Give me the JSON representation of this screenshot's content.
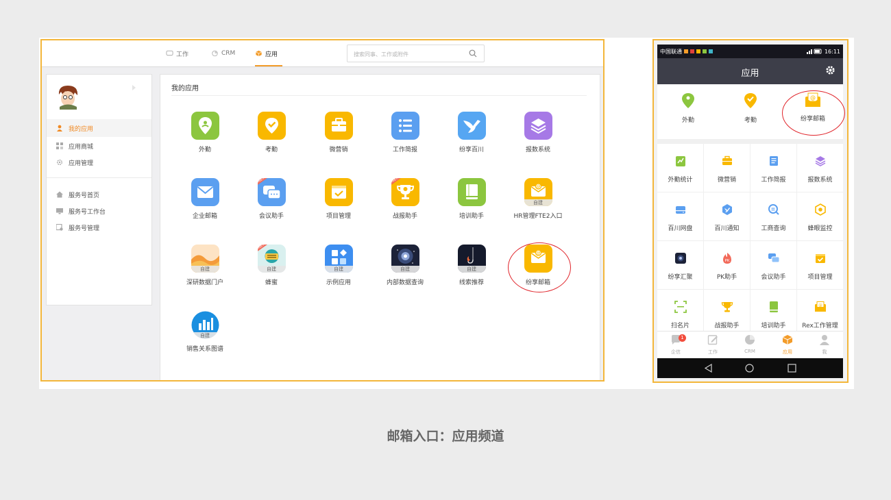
{
  "desktop": {
    "tabs": [
      {
        "label": "工作",
        "icon": "chat-icon"
      },
      {
        "label": "CRM",
        "icon": "pie-icon"
      },
      {
        "label": "应用",
        "icon": "cube-icon",
        "active": true
      }
    ],
    "search_placeholder": "搜索同事、工作或附件",
    "sidebar": {
      "items": [
        {
          "label": "我的应用",
          "icon": "person-icon",
          "active": true
        },
        {
          "label": "应用商城",
          "icon": "grid-icon"
        },
        {
          "label": "应用管理",
          "icon": "gear-icon"
        },
        {
          "label": "服务号首页",
          "icon": "home-icon"
        },
        {
          "label": "服务号工作台",
          "icon": "monitor-icon"
        },
        {
          "label": "服务号管理",
          "icon": "manage-icon"
        }
      ]
    },
    "main": {
      "title": "我的应用",
      "apps": [
        {
          "label": "外勤",
          "color": "#8cc63f",
          "icon": "location-icon"
        },
        {
          "label": "考勤",
          "color": "#f9b800",
          "icon": "check-pin-icon"
        },
        {
          "label": "微营销",
          "color": "#f9b800",
          "icon": "briefcase-icon"
        },
        {
          "label": "工作简报",
          "color": "#5b9ff0",
          "icon": "list-icon"
        },
        {
          "label": "纷享百川",
          "color": "#56a6f2",
          "icon": "bird-icon"
        },
        {
          "label": "报数系统",
          "color": "#a679e6",
          "icon": "layers-icon"
        },
        {
          "label": "企业邮箱",
          "color": "#5b9ff0",
          "icon": "mail-icon"
        },
        {
          "label": "会议助手",
          "color": "#5b9ff0",
          "icon": "chat-bubbles-icon",
          "badge": "NEW"
        },
        {
          "label": "项目管理",
          "color": "#f9b800",
          "icon": "calendar-check-icon"
        },
        {
          "label": "战报助手",
          "color": "#f9b800",
          "icon": "trophy-icon",
          "badge": "NEW"
        },
        {
          "label": "培训助手",
          "color": "#8cc63f",
          "icon": "book-icon"
        },
        {
          "label": "HR管理FTE2入口",
          "color": "#f9b800",
          "icon": "mail-at-icon",
          "self_built": "自建"
        },
        {
          "label": "深研数据门户",
          "color": "#f49b3a",
          "icon": "wave-icon",
          "self_built": "自建"
        },
        {
          "label": "蜂蜜",
          "color": "#2aa6a8",
          "icon": "honey-icon",
          "self_built": "自建",
          "badge": "NEW"
        },
        {
          "label": "示例应用",
          "color": "#3d8ef0",
          "icon": "shapes-icon",
          "self_built": "自建"
        },
        {
          "label": "内部数据查询",
          "color": "#1c2238",
          "icon": "galaxy-icon",
          "self_built": "自建"
        },
        {
          "label": "线索推荐",
          "color": "#151a2c",
          "icon": "fish-hook-icon",
          "self_built": "自建"
        },
        {
          "label": "纷享邮箱",
          "color": "#f9b800",
          "icon": "mail-at-icon"
        },
        {
          "label": "销售关系图谱",
          "color": "#1a8fe0",
          "icon": "bar-chart-icon",
          "self_built": "自建"
        }
      ]
    }
  },
  "phone": {
    "status_left": "中国联通",
    "status_time": "16:11",
    "title": "应用",
    "top_apps": [
      {
        "label": "外勤",
        "color": "#8cc63f",
        "icon": "location-icon"
      },
      {
        "label": "考勤",
        "color": "#f9b800",
        "icon": "check-pin-icon"
      },
      {
        "label": "纷享邮箱",
        "color": "#f9b800",
        "icon": "mail-at-icon"
      }
    ],
    "grid": [
      {
        "label": "外勤统计",
        "color": "#8cc63f",
        "icon": "stats-icon"
      },
      {
        "label": "微营销",
        "color": "#f9b800",
        "icon": "briefcase-icon"
      },
      {
        "label": "工作简报",
        "color": "#5b9ff0",
        "icon": "doc-icon"
      },
      {
        "label": "报数系统",
        "color": "#a679e6",
        "icon": "layers-icon"
      },
      {
        "label": "百川网盘",
        "color": "#5b9ff0",
        "icon": "disk-icon"
      },
      {
        "label": "百川通知",
        "color": "#5b9ff0",
        "icon": "bird-icon"
      },
      {
        "label": "工商查询",
        "color": "#5b9ff0",
        "icon": "search-doc-icon"
      },
      {
        "label": "蜂眼监控",
        "color": "#f9b800",
        "icon": "eye-icon"
      },
      {
        "label": "纷享汇聚",
        "color": "#1c2238",
        "icon": "galaxy-icon"
      },
      {
        "label": "PK助手",
        "color": "#f26a5a",
        "icon": "pk-icon"
      },
      {
        "label": "会议助手",
        "color": "#5b9ff0",
        "icon": "chat-bubbles-icon"
      },
      {
        "label": "项目管理",
        "color": "#f9b800",
        "icon": "calendar-check-icon"
      },
      {
        "label": "扫名片",
        "color": "#8cc63f",
        "icon": "scan-icon"
      },
      {
        "label": "战报助手",
        "color": "#f9b800",
        "icon": "trophy-icon"
      },
      {
        "label": "培训助手",
        "color": "#8cc63f",
        "icon": "book-icon"
      },
      {
        "label": "Rex工作管理",
        "color": "#f9b800",
        "icon": "mail-at-icon"
      }
    ],
    "tabs": [
      {
        "label": "企信",
        "icon": "chat-icon",
        "badge": "1"
      },
      {
        "label": "工作",
        "icon": "edit-icon"
      },
      {
        "label": "CRM",
        "icon": "pie-icon"
      },
      {
        "label": "应用",
        "icon": "cube-icon",
        "active": true
      },
      {
        "label": "我",
        "icon": "person-icon"
      }
    ]
  },
  "caption": "邮箱入口：应用频道"
}
